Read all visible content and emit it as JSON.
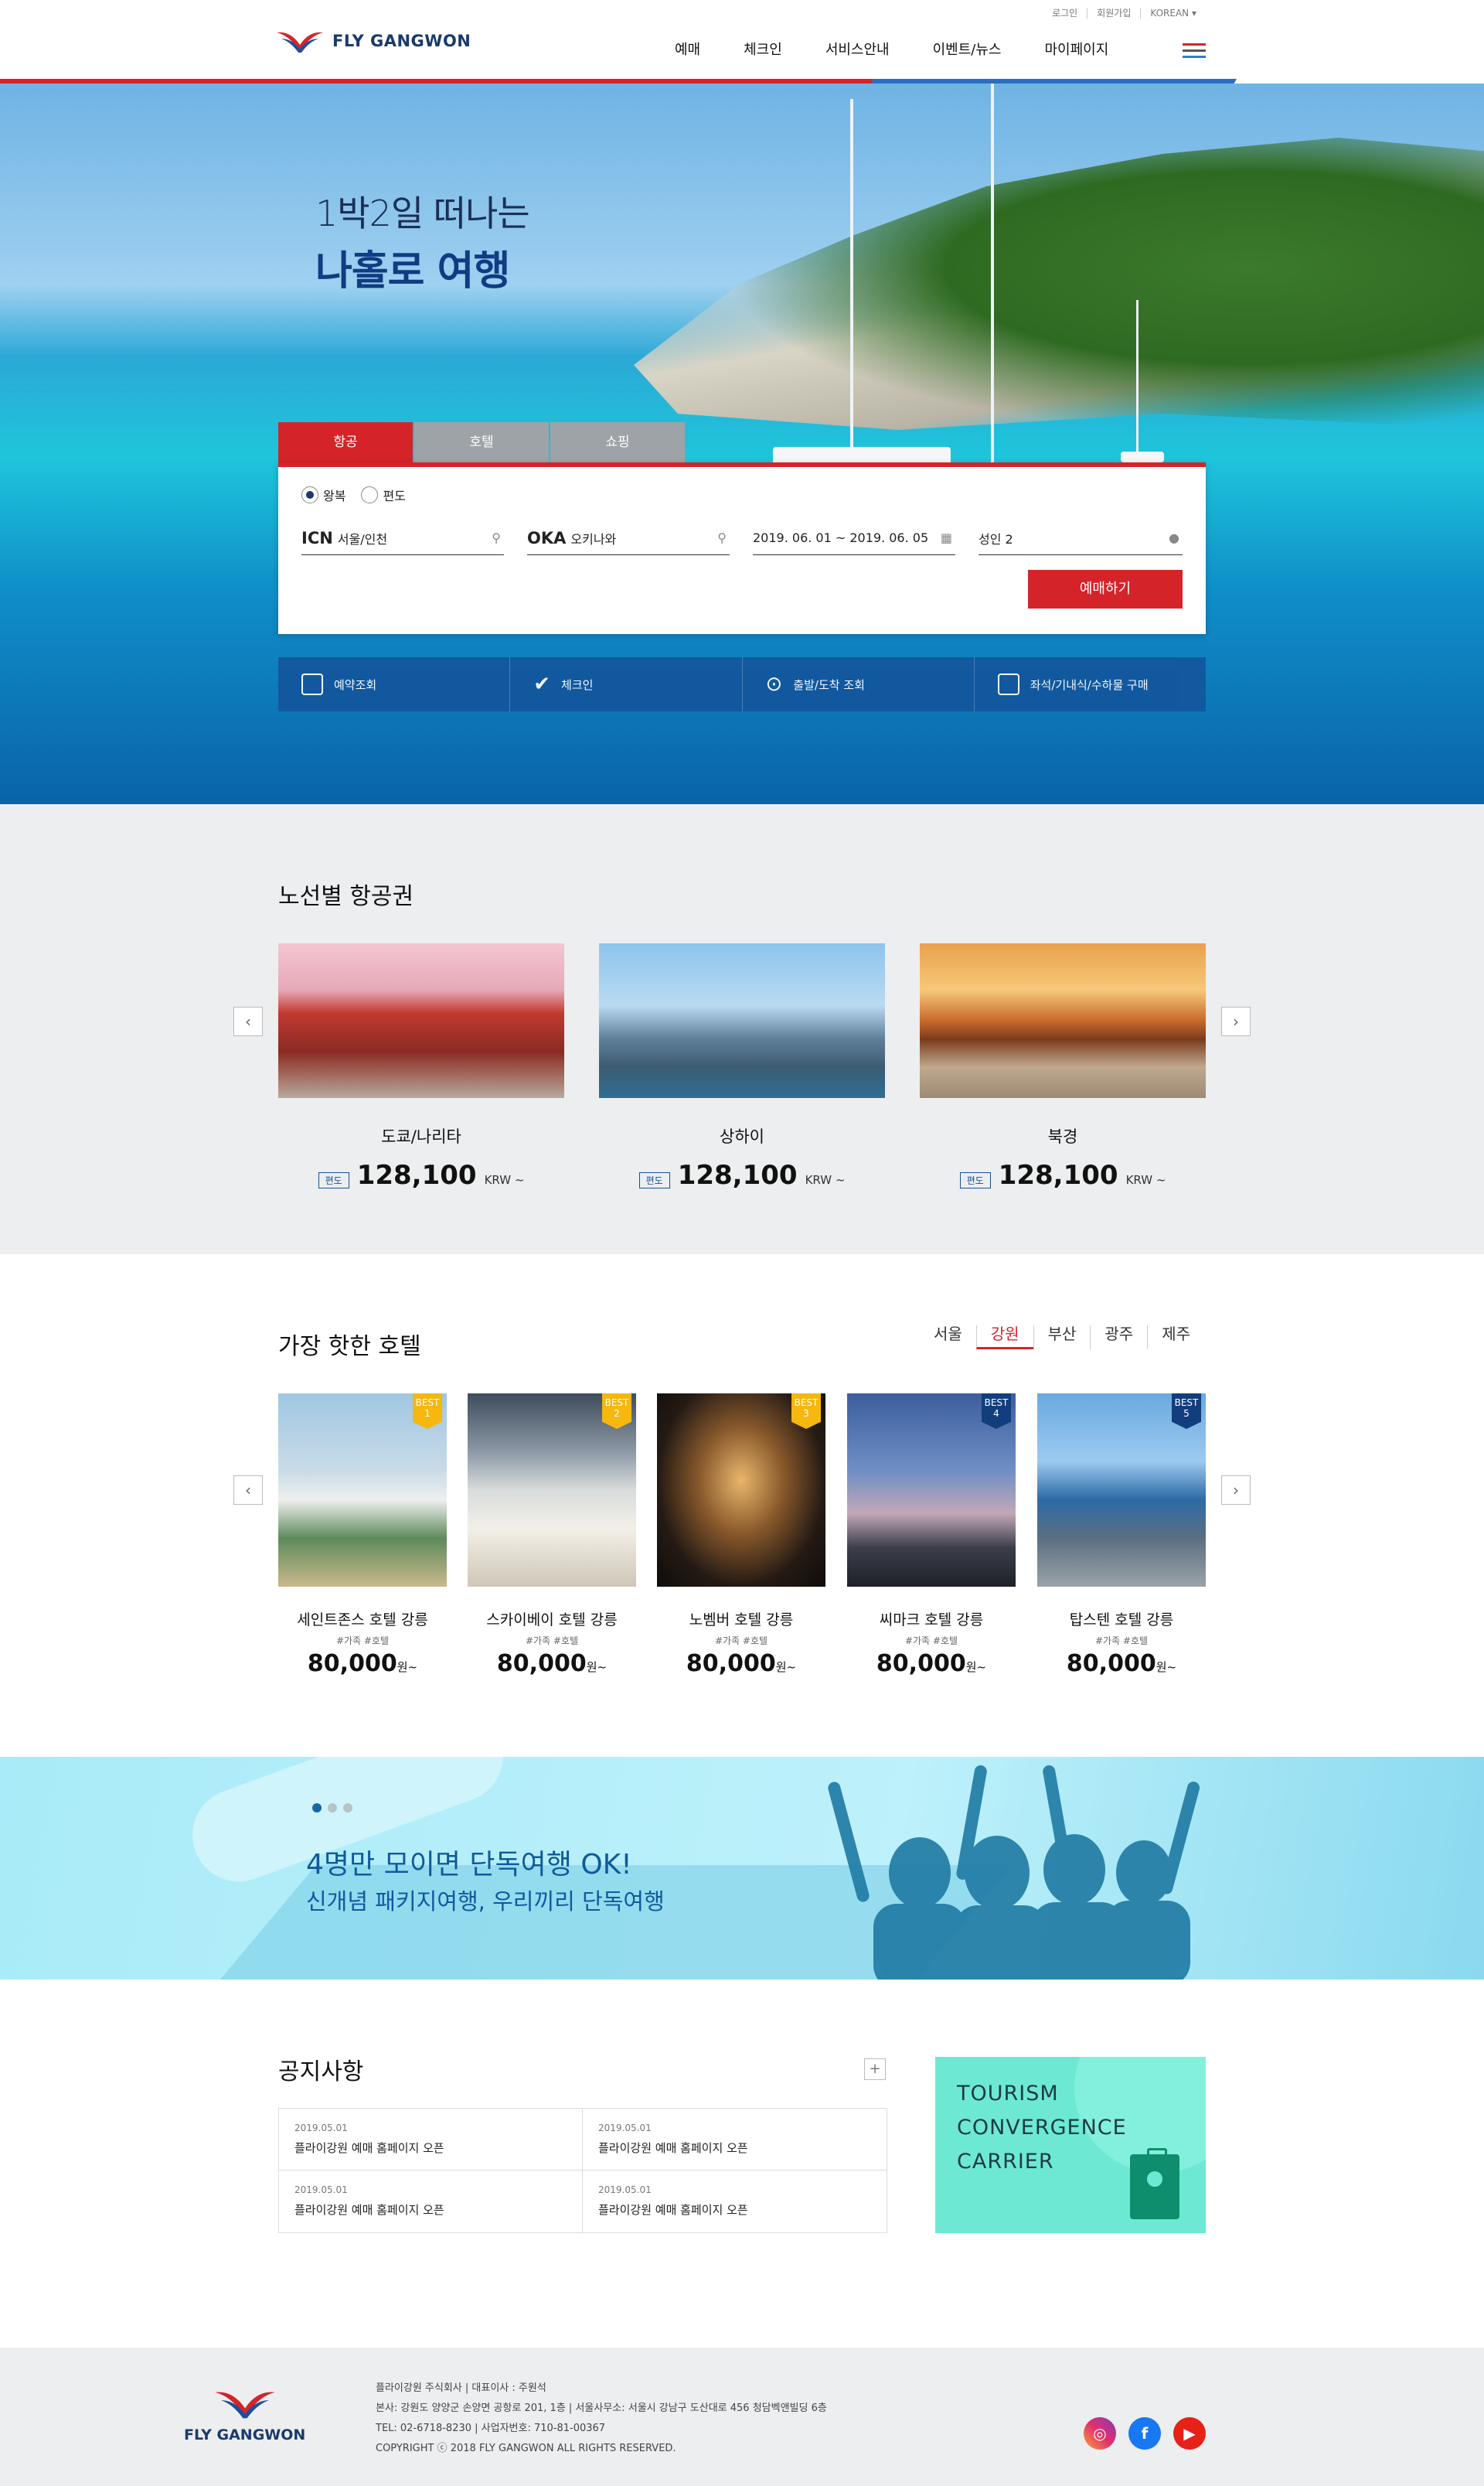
{
  "header": {
    "utils": [
      "로그인",
      "회원가입",
      "KOREAN ▾"
    ],
    "logo": "FLY GANGWON",
    "nav": [
      "예매",
      "체크인",
      "서비스안내",
      "이벤트/뉴스",
      "마이페이지"
    ]
  },
  "hero": {
    "line1": "1박2일 떠나는",
    "line2": "나홀로 여행"
  },
  "booking": {
    "tabs": [
      "항공",
      "호텔",
      "쇼핑"
    ],
    "radios": [
      "왕복",
      "편도"
    ],
    "from_code": "ICN",
    "from_city": "서울/인천",
    "to_code": "OKA",
    "to_city": "오키나와",
    "dates": "2019. 06. 01 ~ 2019. 06. 05",
    "pax": "성인 2",
    "submit": "예매하기"
  },
  "quick": [
    "예약조회",
    "체크인",
    "출발/도착 조회",
    "좌석/기내식/수하물 구매"
  ],
  "routes": {
    "title": "노선별 항공권",
    "items": [
      {
        "city": "도쿄/나리타",
        "tag": "편도",
        "price": "128,100",
        "unit": "KRW ~"
      },
      {
        "city": "상하이",
        "tag": "편도",
        "price": "128,100",
        "unit": "KRW ~"
      },
      {
        "city": "북경",
        "tag": "편도",
        "price": "128,100",
        "unit": "KRW ~"
      }
    ]
  },
  "hotels": {
    "title": "가장 핫한 호텔",
    "cities": [
      "서울",
      "강원",
      "부산",
      "광주",
      "제주"
    ],
    "active_city": "강원",
    "items": [
      {
        "name": "세인트존스 호텔 강릉",
        "tags": "#가족  #호텔",
        "price": "80,000",
        "unit": "원~",
        "badge": "BEST",
        "rank": "1"
      },
      {
        "name": "스카이베이 호텔 강릉",
        "tags": "#가족  #호텔",
        "price": "80,000",
        "unit": "원~",
        "badge": "BEST",
        "rank": "2"
      },
      {
        "name": "노벰버 호텔 강릉",
        "tags": "#가족  #호텔",
        "price": "80,000",
        "unit": "원~",
        "badge": "BEST",
        "rank": "3"
      },
      {
        "name": "씨마크 호텔 강릉",
        "tags": "#가족  #호텔",
        "price": "80,000",
        "unit": "원~",
        "badge": "BEST",
        "rank": "4"
      },
      {
        "name": "탑스텐 호텔 강릉",
        "tags": "#가족  #호텔",
        "price": "80,000",
        "unit": "원~",
        "badge": "BEST",
        "rank": "5"
      }
    ]
  },
  "banner": {
    "line1": "4명만 모이면 단독여행 OK!",
    "line2": "신개념 패키지여행, 우리끼리 단독여행"
  },
  "notice": {
    "title": "공지사항",
    "items": [
      {
        "date": "2019.05.01",
        "text": "플라이강원 예매 홈페이지 오픈"
      },
      {
        "date": "2019.05.01",
        "text": "플라이강원 예매 홈페이지 오픈"
      },
      {
        "date": "2019.05.01",
        "text": "플라이강원 예매 홈페이지 오픈"
      },
      {
        "date": "2019.05.01",
        "text": "플라이강원 예매 홈페이지 오픈"
      }
    ]
  },
  "tcc": {
    "line1": "TOURISM",
    "line2": "CONVERGENCE",
    "line3": "CARRIER"
  },
  "footer": {
    "logo": "FLY GANGWON",
    "line1": "플라이강원 주식회사  |  대표이사 : 주원석",
    "line2": "본사: 강원도 양양군 손양면 공항로 201, 1층  |  서울사무소: 서울시 강남구 도산대로 456 청담벡앤빌딩 6층",
    "line3": "TEL: 02-6718-8230  |  사업자번호: 710-81-00367",
    "line4": "COPYRIGHT ⓒ 2018 FLY GANGWON ALL RIGHTS RESERVED."
  },
  "colors": {
    "brand_red": "#d4242a",
    "brand_navy": "#1a3a6b",
    "quick_blue": "#13579e",
    "best_yellow": "#f6b70f"
  },
  "icons": [
    "location-pin-icon",
    "calendar-icon",
    "person-icon",
    "check-icon",
    "seat-icon",
    "instagram-icon",
    "facebook-icon",
    "youtube-icon",
    "plus-icon",
    "chevron-left-icon",
    "chevron-right-icon",
    "menu-icon"
  ]
}
